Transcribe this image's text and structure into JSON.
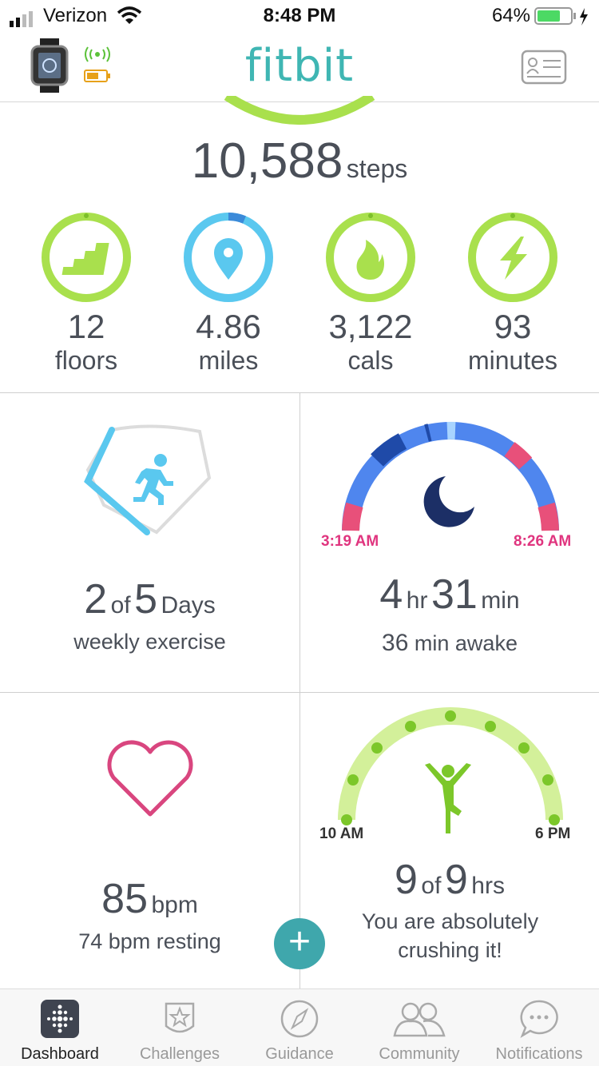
{
  "status_bar": {
    "carrier": "Verizon",
    "time": "8:48 PM",
    "battery": "64%"
  },
  "header": {
    "logo": "fitbit",
    "device_icon": "watch-icon",
    "profile_icon": "id-card-icon",
    "accent": "#3fb6b3"
  },
  "steps": {
    "value": "10,588",
    "unit": "steps"
  },
  "stats": [
    {
      "value": "12",
      "label": "floors",
      "icon": "stairs-icon"
    },
    {
      "value": "4.86",
      "label": "miles",
      "icon": "location-pin-icon"
    },
    {
      "value": "3,122",
      "label": "cals",
      "icon": "flame-icon"
    },
    {
      "value": "93",
      "label": "minutes",
      "icon": "lightning-icon"
    }
  ],
  "exercise": {
    "done": "2",
    "of": "of",
    "goal": "5",
    "unit": "Days",
    "label": "weekly exercise"
  },
  "sleep": {
    "start": "3:19 AM",
    "end": "8:26 AM",
    "hours": "4",
    "hr": "hr",
    "minutes": "31",
    "min": "min",
    "awake_value": "36",
    "awake_label": "min awake"
  },
  "heart": {
    "value": "85",
    "unit": "bpm",
    "resting": "74 bpm resting"
  },
  "hourly": {
    "start": "10 AM",
    "end": "6 PM",
    "done": "9",
    "of": "of",
    "goal": "9",
    "unit": "hrs",
    "message": "You are absolutely crushing it!"
  },
  "fab": {
    "label": "+"
  },
  "tabs": [
    {
      "label": "Dashboard",
      "icon": "dashboard-icon"
    },
    {
      "label": "Challenges",
      "icon": "star-badge-icon"
    },
    {
      "label": "Guidance",
      "icon": "compass-icon"
    },
    {
      "label": "Community",
      "icon": "people-icon"
    },
    {
      "label": "Notifications",
      "icon": "chat-bubble-icon"
    }
  ],
  "colors": {
    "green": "#a9e04d",
    "blue": "#5ac8ef",
    "pink": "#e0357f",
    "teal": "#3fa7ac"
  }
}
